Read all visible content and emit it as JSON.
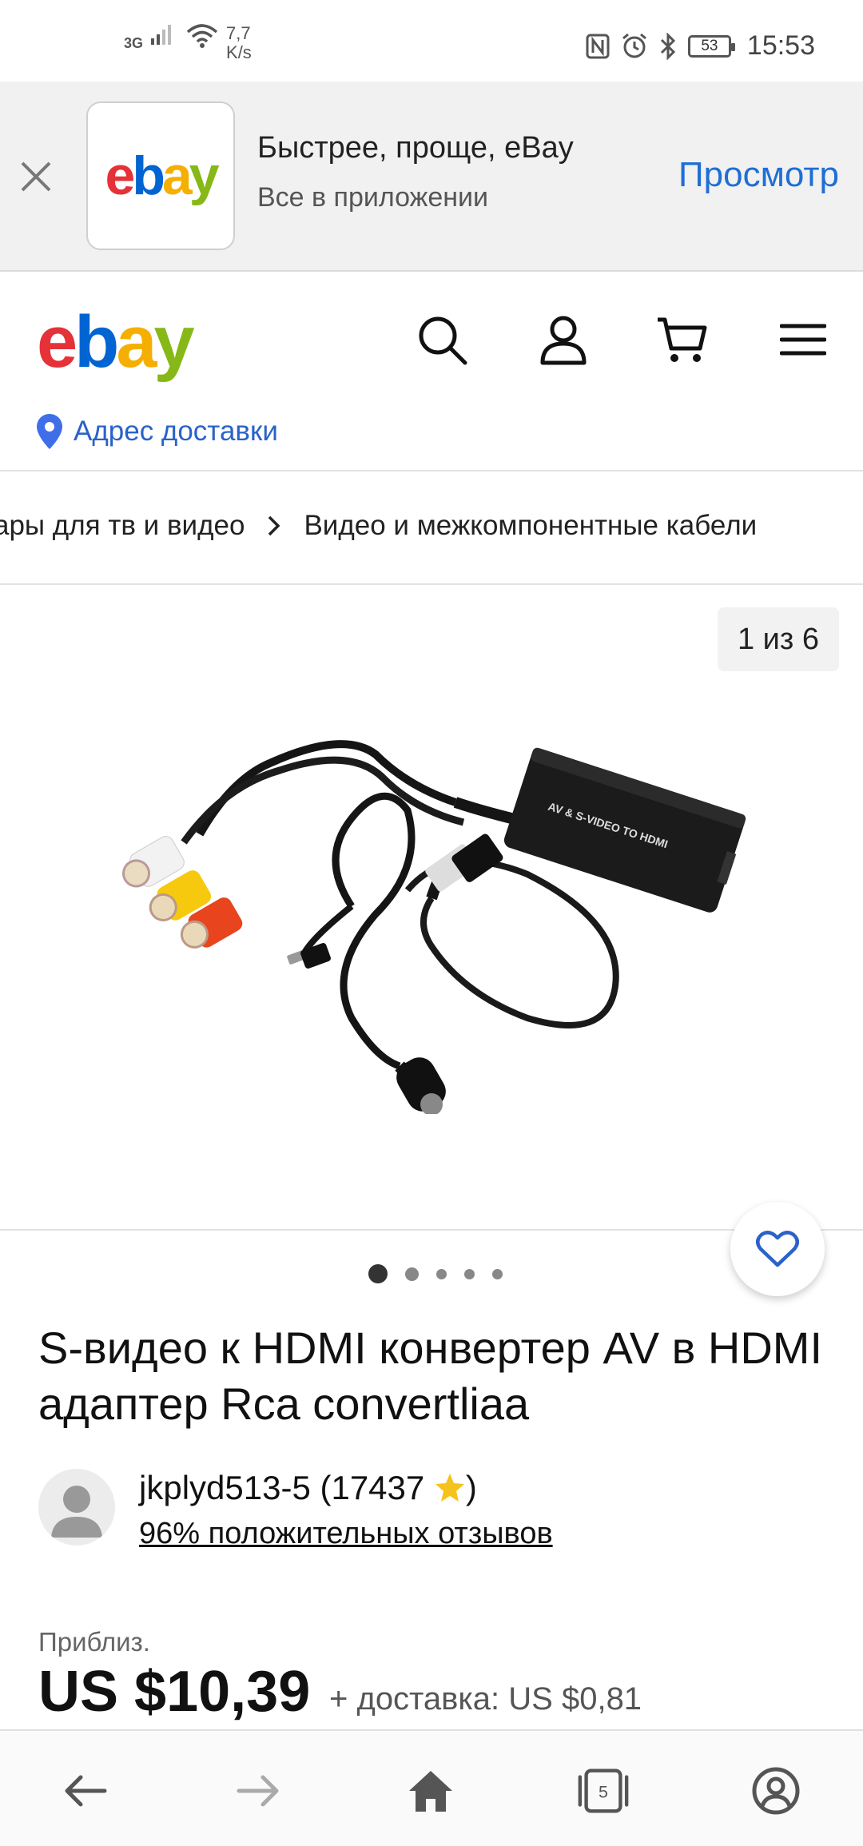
{
  "status_bar": {
    "network": "3G",
    "speed_value": "7,7",
    "speed_unit": "K/s",
    "battery": "53",
    "time": "15:53"
  },
  "app_banner": {
    "title": "Быстрее, проще, eBay",
    "subtitle": "Все в приложении",
    "view_label": "Просмотр",
    "logo": {
      "e": "e",
      "b": "b",
      "a": "a",
      "y": "y"
    }
  },
  "header": {
    "logo": {
      "e": "e",
      "b": "b",
      "a": "a",
      "y": "y"
    },
    "address_label": "Адрес доставки"
  },
  "breadcrumb": {
    "items": [
      "ары для тв и видео",
      "Видео и межкомпонентные кабели"
    ]
  },
  "gallery": {
    "counter": "1 из 6",
    "box_label": "AV & S-VIDEO TO HDMI",
    "dots_total": 5,
    "dots_active": 0
  },
  "product": {
    "title": "S-видео к HDMI конвертер AV в HDMI адаптер Rca convertliaa",
    "seller_name": "jkplyd513-5 (17437",
    "seller_close": ")",
    "seller_feedback": "96% положительных отзывов",
    "approx_label": "Приблиз.",
    "price": "US $10,39",
    "shipping": "+ доставка: US $0,81"
  },
  "bottom_nav": {
    "tabs_count": "5"
  },
  "colors": {
    "link_blue": "#1f6ed4",
    "address_blue": "#2a62c9",
    "ebay_red": "#e53238",
    "ebay_blue": "#0064d2",
    "ebay_yellow": "#f5af02",
    "ebay_green": "#86b817"
  }
}
